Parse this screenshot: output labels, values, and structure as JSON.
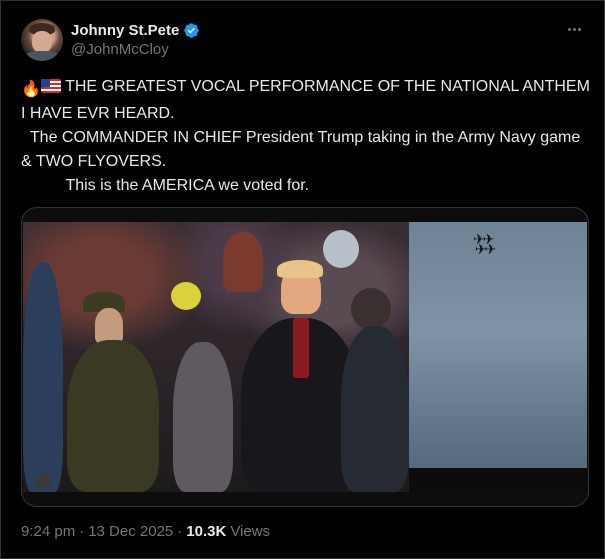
{
  "author": {
    "display_name": "Johnny St.Pete",
    "handle": "@JohnMcCloy",
    "verified": true
  },
  "tweet": {
    "line1": " THE GREATEST VOCAL PERFORMANCE OF THE NATIONAL ANTHEM I HAVE EVR HEARD.",
    "line2": "  The COMMANDER IN CHIEF President Trump taking in the Army Navy game & TWO FLYOVERS.",
    "line3": "          This is the AMERICA we voted for.",
    "emoji_fire": "🔥",
    "emoji_flag_icon": "us-flag-icon"
  },
  "media": {
    "type": "video",
    "left_scene": "crowd",
    "right_scene": "sky with jets"
  },
  "meta": {
    "time": "9:24 pm",
    "separator1": "·",
    "date": "13 Dec 2025",
    "separator2": "·",
    "views_count": "10.3K",
    "views_label": "Views"
  },
  "colors": {
    "background": "#000000",
    "text": "#e7e9ea",
    "secondary": "#71767b",
    "verified": "#1d9bf0",
    "border": "#2f3336"
  }
}
